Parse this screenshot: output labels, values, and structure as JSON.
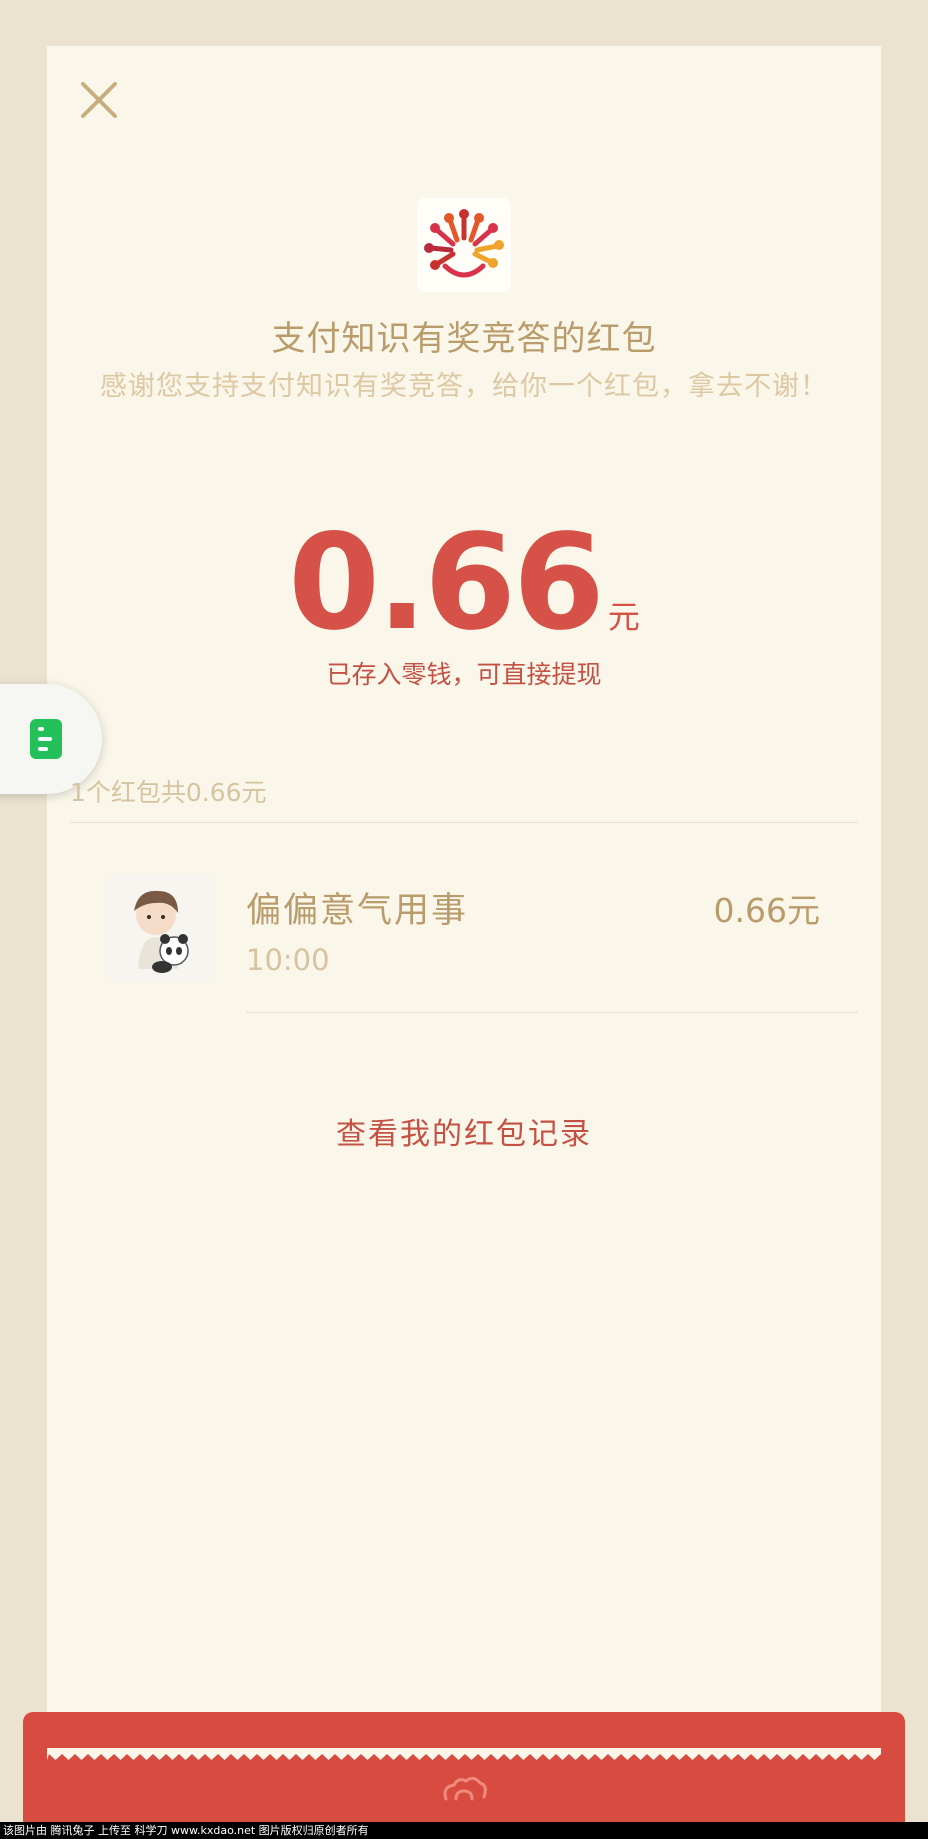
{
  "header": {
    "close_icon": "close-icon",
    "logo_icon": "smiley-burst-logo-icon"
  },
  "packet": {
    "title": "支付知识有奖竞答的红包",
    "description": "感谢您支持支付知识有奖竞答，给你一个红包，拿去不谢！",
    "amount": "0.66",
    "currency": "元",
    "saved_note": "已存入零钱，可直接提现"
  },
  "summary": {
    "text": "1个红包共0.66元"
  },
  "records": [
    {
      "name": "偏偏意气用事",
      "time": "10:00",
      "amount": "0.66元",
      "avatar_icon": "boy-with-panda-avatar"
    }
  ],
  "actions": {
    "view_records": "查看我的红包记录"
  },
  "floating_tab": {
    "icon": "document-list-icon"
  },
  "footer": {
    "watermark": "该图片由 腾讯兔子 上传至 科学刀 www.kxdao.net 图片版权归原创者所有"
  },
  "colors": {
    "background": "#ebe3cf",
    "card": "#fbf6ea",
    "gold_text": "#b99c6b",
    "light_gold_text": "#d6c4a0",
    "red": "#d65147",
    "band_red": "#d84b40",
    "green": "#24c05a"
  }
}
